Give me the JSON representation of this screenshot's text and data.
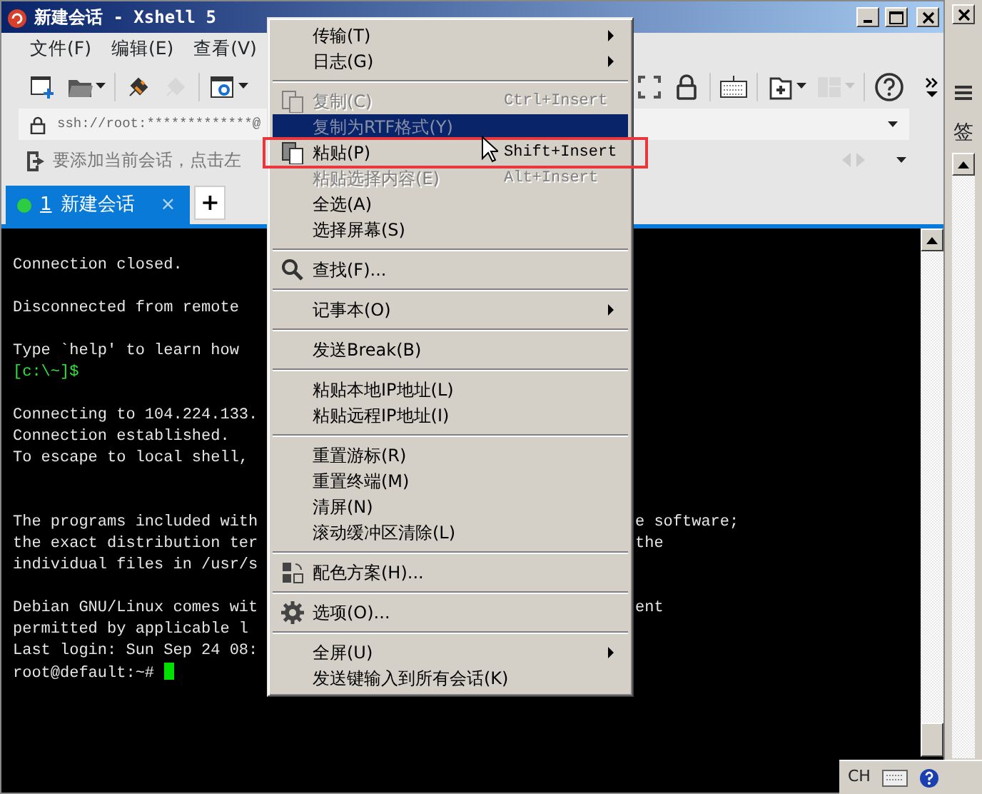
{
  "window": {
    "title": "新建会话 - Xshell 5"
  },
  "menu_bar": [
    {
      "label": "文件(F)"
    },
    {
      "label": "编辑(E)"
    },
    {
      "label": "查看(V)"
    }
  ],
  "toolbar": [
    {
      "kind": "new",
      "disabled": false,
      "caret": false
    },
    {
      "kind": "open",
      "disabled": false,
      "caret": true
    },
    {
      "kind": "connect",
      "disabled": false,
      "caret": false
    },
    {
      "kind": "disconnect",
      "disabled": true,
      "caret": false
    },
    {
      "kind": "properties",
      "disabled": false,
      "caret": true
    },
    {
      "kind": "fullscreen",
      "disabled": false,
      "caret": false
    },
    {
      "kind": "lock",
      "disabled": false,
      "caret": false
    },
    {
      "kind": "keyboard",
      "disabled": false,
      "caret": false
    },
    {
      "kind": "newfolder",
      "disabled": false,
      "caret": true
    },
    {
      "kind": "layout",
      "disabled": true,
      "caret": true
    },
    {
      "kind": "help",
      "disabled": false,
      "caret": false
    }
  ],
  "address": {
    "value": "ssh://root:*************@"
  },
  "info_bar": {
    "text": "要添加当前会话，点击左"
  },
  "tabs": [
    {
      "number": "1",
      "label": "新建会话",
      "selected": true,
      "connected": true,
      "close": "×"
    }
  ],
  "add_tab": "+",
  "terminal": [
    {
      "kind": "blank"
    },
    {
      "kind": "text",
      "left": "Connection closed."
    },
    {
      "kind": "blank"
    },
    {
      "kind": "text",
      "left": "Disconnected from remote"
    },
    {
      "kind": "blank"
    },
    {
      "kind": "text",
      "left": "Type `help' to learn how"
    },
    {
      "kind": "prompt",
      "left": "[c:\\~]$"
    },
    {
      "kind": "blank"
    },
    {
      "kind": "text",
      "left": "Connecting to 104.224.133."
    },
    {
      "kind": "text",
      "left": "Connection established."
    },
    {
      "kind": "text",
      "left": "To escape to local shell,"
    },
    {
      "kind": "blank"
    },
    {
      "kind": "blank"
    },
    {
      "kind": "text",
      "left": "The programs included with",
      "right": "e software;"
    },
    {
      "kind": "text",
      "left": "the exact distribution ter",
      "right": "the"
    },
    {
      "kind": "text",
      "left": "individual files in /usr/s"
    },
    {
      "kind": "blank"
    },
    {
      "kind": "text",
      "left": "Debian GNU/Linux comes wit",
      "right": "ent"
    },
    {
      "kind": "text",
      "left": "permitted by applicable l"
    },
    {
      "kind": "text",
      "left": "Last login: Sun Sep 24 08:"
    },
    {
      "kind": "shell",
      "left": "root@default:~#"
    }
  ],
  "context_menu": [
    {
      "kind": "item",
      "label": "传输(T)",
      "submenu": true,
      "disabled": false,
      "selected": false
    },
    {
      "kind": "item",
      "label": "日志(G)",
      "submenu": true,
      "disabled": false,
      "selected": false
    },
    {
      "kind": "separator"
    },
    {
      "kind": "item",
      "label": "复制(C)",
      "shortcut": "Ctrl+Insert",
      "disabled": true,
      "selected": false
    },
    {
      "kind": "item",
      "label": "复制为RTF格式(Y)",
      "disabled": true,
      "selected": true
    },
    {
      "kind": "item",
      "label": "粘贴(P)",
      "shortcut": "Shift+Insert",
      "disabled": false,
      "selected": false,
      "outlined": true
    },
    {
      "kind": "item",
      "label": "粘贴选择内容(E)",
      "shortcut": "Alt+Insert",
      "disabled": true,
      "selected": false
    },
    {
      "kind": "item",
      "label": "全选(A)",
      "disabled": false,
      "selected": false
    },
    {
      "kind": "item",
      "label": "选择屏幕(S)",
      "disabled": false,
      "selected": false
    },
    {
      "kind": "separator"
    },
    {
      "kind": "item",
      "label": "查找(F)...",
      "disabled": false,
      "selected": false
    },
    {
      "kind": "separator"
    },
    {
      "kind": "item",
      "label": "记事本(O)",
      "submenu": true,
      "disabled": false,
      "selected": false
    },
    {
      "kind": "separator"
    },
    {
      "kind": "item",
      "label": "发送Break(B)",
      "disabled": false,
      "selected": false
    },
    {
      "kind": "separator"
    },
    {
      "kind": "item",
      "label": "粘贴本地IP地址(L)",
      "disabled": false,
      "selected": false
    },
    {
      "kind": "item",
      "label": "粘贴远程IP地址(I)",
      "disabled": false,
      "selected": false
    },
    {
      "kind": "separator"
    },
    {
      "kind": "item",
      "label": "重置游标(R)",
      "disabled": false,
      "selected": false
    },
    {
      "kind": "item",
      "label": "重置终端(M)",
      "disabled": false,
      "selected": false
    },
    {
      "kind": "item",
      "label": "清屏(N)",
      "disabled": false,
      "selected": false
    },
    {
      "kind": "item",
      "label": "滚动缓冲区清除(L)",
      "disabled": false,
      "selected": false
    },
    {
      "kind": "separator"
    },
    {
      "kind": "item",
      "label": "配色方案(H)...",
      "disabled": false,
      "selected": false
    },
    {
      "kind": "separator"
    },
    {
      "kind": "item",
      "label": "选项(O)...",
      "disabled": false,
      "selected": false
    },
    {
      "kind": "separator"
    },
    {
      "kind": "item",
      "label": "全屏(U)",
      "submenu": true,
      "disabled": false,
      "selected": false
    },
    {
      "kind": "item",
      "label": "发送键输入到所有会话(K)",
      "disabled": false,
      "selected": false
    }
  ],
  "side_window": {
    "text": "签"
  },
  "taskbar": {
    "language": "CH"
  }
}
